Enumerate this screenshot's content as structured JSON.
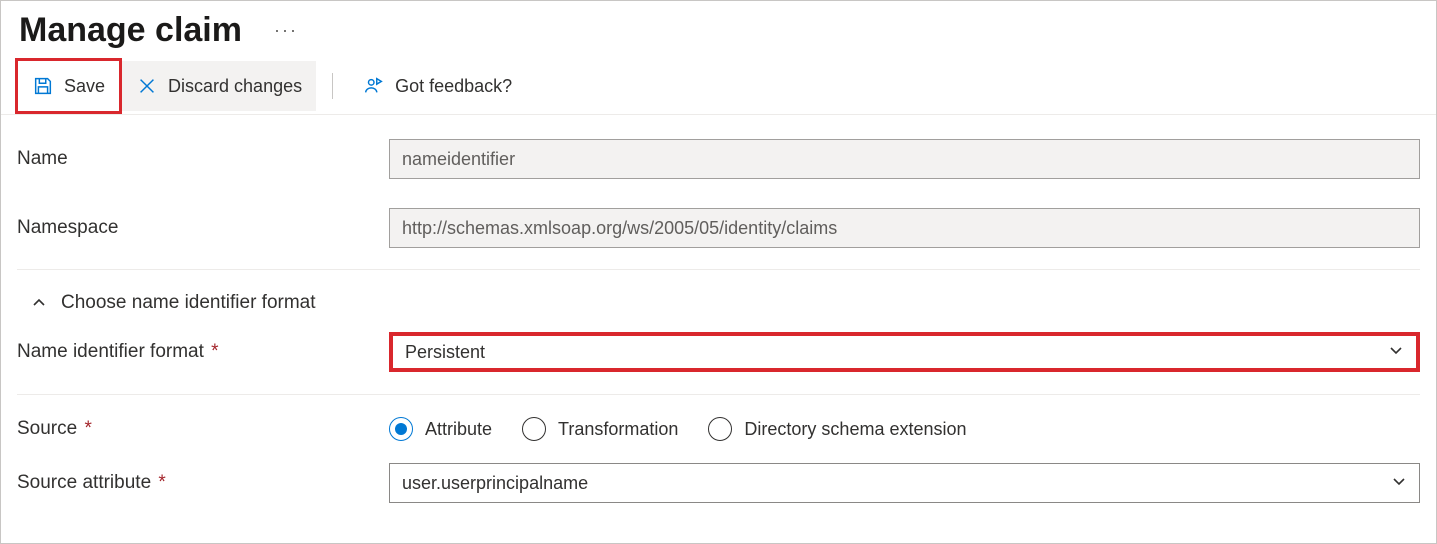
{
  "header": {
    "title": "Manage claim"
  },
  "toolbar": {
    "save_label": "Save",
    "discard_label": "Discard changes",
    "feedback_label": "Got feedback?"
  },
  "fields": {
    "name_label": "Name",
    "name_value": "nameidentifier",
    "namespace_label": "Namespace",
    "namespace_value": "http://schemas.xmlsoap.org/ws/2005/05/identity/claims"
  },
  "expander": {
    "label": "Choose name identifier format"
  },
  "name_id_format": {
    "label": "Name identifier format",
    "value": "Persistent"
  },
  "source": {
    "label": "Source",
    "options": {
      "attribute": "Attribute",
      "transformation": "Transformation",
      "directory": "Directory schema extension"
    },
    "selected": "attribute"
  },
  "source_attribute": {
    "label": "Source attribute",
    "value": "user.userprincipalname"
  }
}
